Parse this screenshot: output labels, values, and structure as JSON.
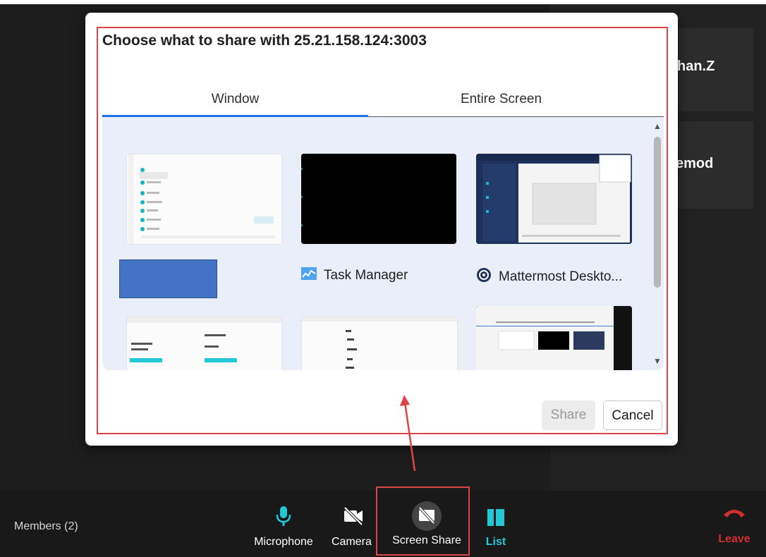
{
  "dialog": {
    "title": "Choose what to share with 25.21.158.124:3003",
    "tabs": [
      {
        "label": "Window",
        "active": true
      },
      {
        "label": "Entire Screen",
        "active": false
      }
    ],
    "windows": [
      {
        "label": ""
      },
      {
        "label": ""
      },
      {
        "label": ""
      },
      {
        "label": ""
      },
      {
        "label": "Task Manager",
        "icon": "task-manager-icon"
      },
      {
        "label": "Mattermost Deskto...",
        "icon": "mattermost-icon"
      },
      {
        "label": ""
      },
      {
        "label": ""
      },
      {
        "label": ""
      }
    ],
    "share_label": "Share",
    "cancel_label": "Cancel"
  },
  "participants": [
    {
      "name": "han.Z"
    },
    {
      "name": "emod"
    }
  ],
  "bottom_bar": {
    "members_label": "Members (2)",
    "microphone_label": "Microphone",
    "camera_label": "Camera",
    "screen_share_label": "Screen Share",
    "list_label": "List",
    "leave_label": "Leave"
  },
  "colors": {
    "accent_cyan": "#22c8d6",
    "leave_red": "#d32f2f",
    "annotation_red": "#e04545",
    "tab_active": "#1a73e8"
  }
}
